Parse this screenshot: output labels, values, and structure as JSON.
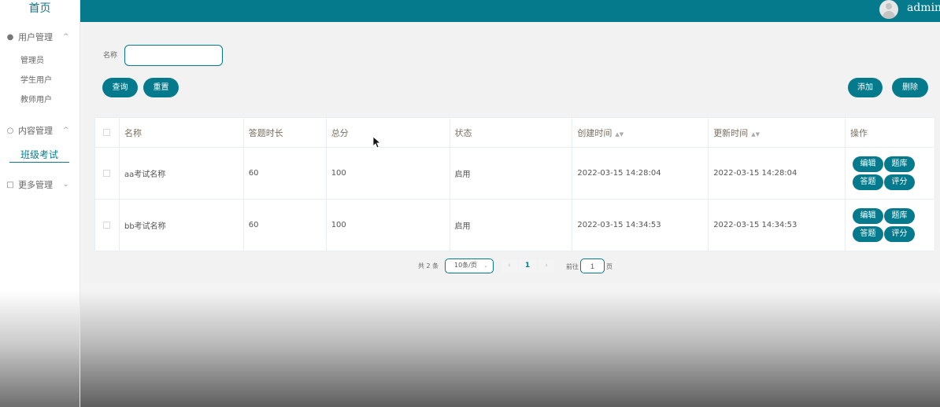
{
  "sidebar": {
    "home": "首页",
    "groups": [
      {
        "label": "用户管理",
        "items": [
          "管理员",
          "学生用户",
          "教师用户"
        ]
      },
      {
        "label": "内容管理",
        "items": [
          "班级考试"
        ]
      },
      {
        "label": "更多管理",
        "items": []
      }
    ]
  },
  "header": {
    "user": "admin"
  },
  "search": {
    "name_label": "名称",
    "name_value": "",
    "query_label": "查询",
    "reset_label": "重置"
  },
  "actions": {
    "add_label": "添加",
    "delete_label": "删除"
  },
  "table": {
    "headers": [
      "名称",
      "答题时长",
      "总分",
      "状态",
      "创建时间",
      "更新时间",
      "操作"
    ],
    "rows": [
      {
        "name": "aa考试名称",
        "duration": "60",
        "score": "100",
        "status": "启用",
        "created": "2022-03-15 14:28:04",
        "updated": "2022-03-15 14:28:04"
      },
      {
        "name": "bb考试名称",
        "duration": "60",
        "score": "100",
        "status": "启用",
        "created": "2022-03-15 14:34:53",
        "updated": "2022-03-15 14:34:53"
      }
    ],
    "row_actions": [
      "编辑",
      "题库",
      "答题",
      "评分"
    ]
  },
  "pagination": {
    "total_text": "共 2 条",
    "page_size": "10条/页",
    "current_page": "1",
    "goto_label": "前往",
    "goto_value": "1",
    "page_suffix": "页"
  },
  "colors": {
    "primary": "#047a8c",
    "background": "#f2f2f2"
  }
}
